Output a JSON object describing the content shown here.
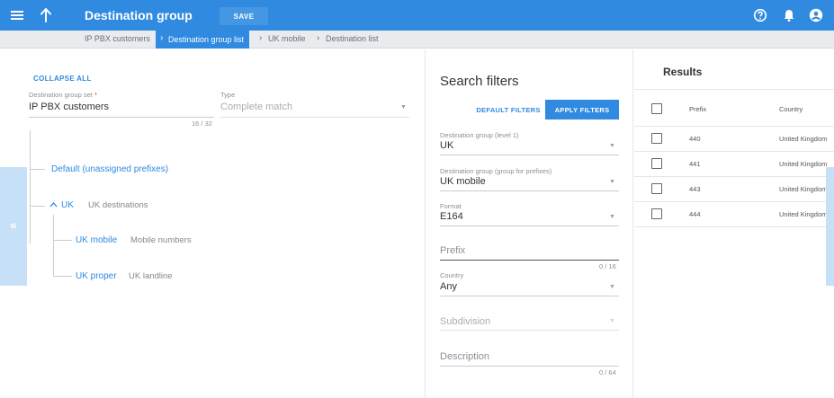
{
  "header": {
    "title": "Destination group",
    "save_label": "SAVE",
    "icons": [
      "menu-icon",
      "arrow-up-icon",
      "help-icon",
      "bell-icon",
      "account-icon"
    ]
  },
  "breadcrumb": [
    "IP PBX customers",
    "Destination group list",
    "UK mobile",
    "Destination list"
  ],
  "left": {
    "collapse_all": "COLLAPSE ALL",
    "group_set": {
      "label": "Destination group set",
      "value": "IP PBX customers",
      "counter": "16 / 32"
    },
    "type": {
      "label": "Type",
      "value": "Complete match"
    },
    "tree": {
      "default": "Default (unassigned prefixes)",
      "uk": {
        "name": "UK",
        "desc": "UK destinations"
      },
      "uk_mobile": {
        "name": "UK mobile",
        "desc": "Mobile numbers"
      },
      "uk_proper": {
        "name": "UK proper",
        "desc": "UK landline"
      }
    }
  },
  "filters": {
    "title": "Search filters",
    "default_btn": "DEFAULT FILTERS",
    "apply_btn": "APPLY FILTERS",
    "level1": {
      "label": "Destination group (level 1)",
      "value": "UK"
    },
    "group_prefixes": {
      "label": "Destination group (group for prefixes)",
      "value": "UK mobile"
    },
    "format": {
      "label": "Format",
      "value": "E164"
    },
    "prefix": {
      "placeholder": "Prefix",
      "counter": "0 / 16"
    },
    "country": {
      "label": "Country",
      "value": "Any"
    },
    "subdivision": {
      "placeholder": "Subdivision"
    },
    "description": {
      "placeholder": "Description",
      "counter": "0 / 64"
    }
  },
  "results": {
    "title": "Results",
    "columns": [
      "Prefix",
      "Country"
    ],
    "rows": [
      {
        "prefix": "440",
        "country": "United Kingdom"
      },
      {
        "prefix": "441",
        "country": "United Kingdom"
      },
      {
        "prefix": "443",
        "country": "United Kingdom"
      },
      {
        "prefix": "444",
        "country": "United Kingdom"
      }
    ]
  },
  "colors": {
    "accent": "#2f8ae0",
    "sidetab": "#c6e1f7",
    "breadcrumb_bg": "#e9ebee"
  }
}
